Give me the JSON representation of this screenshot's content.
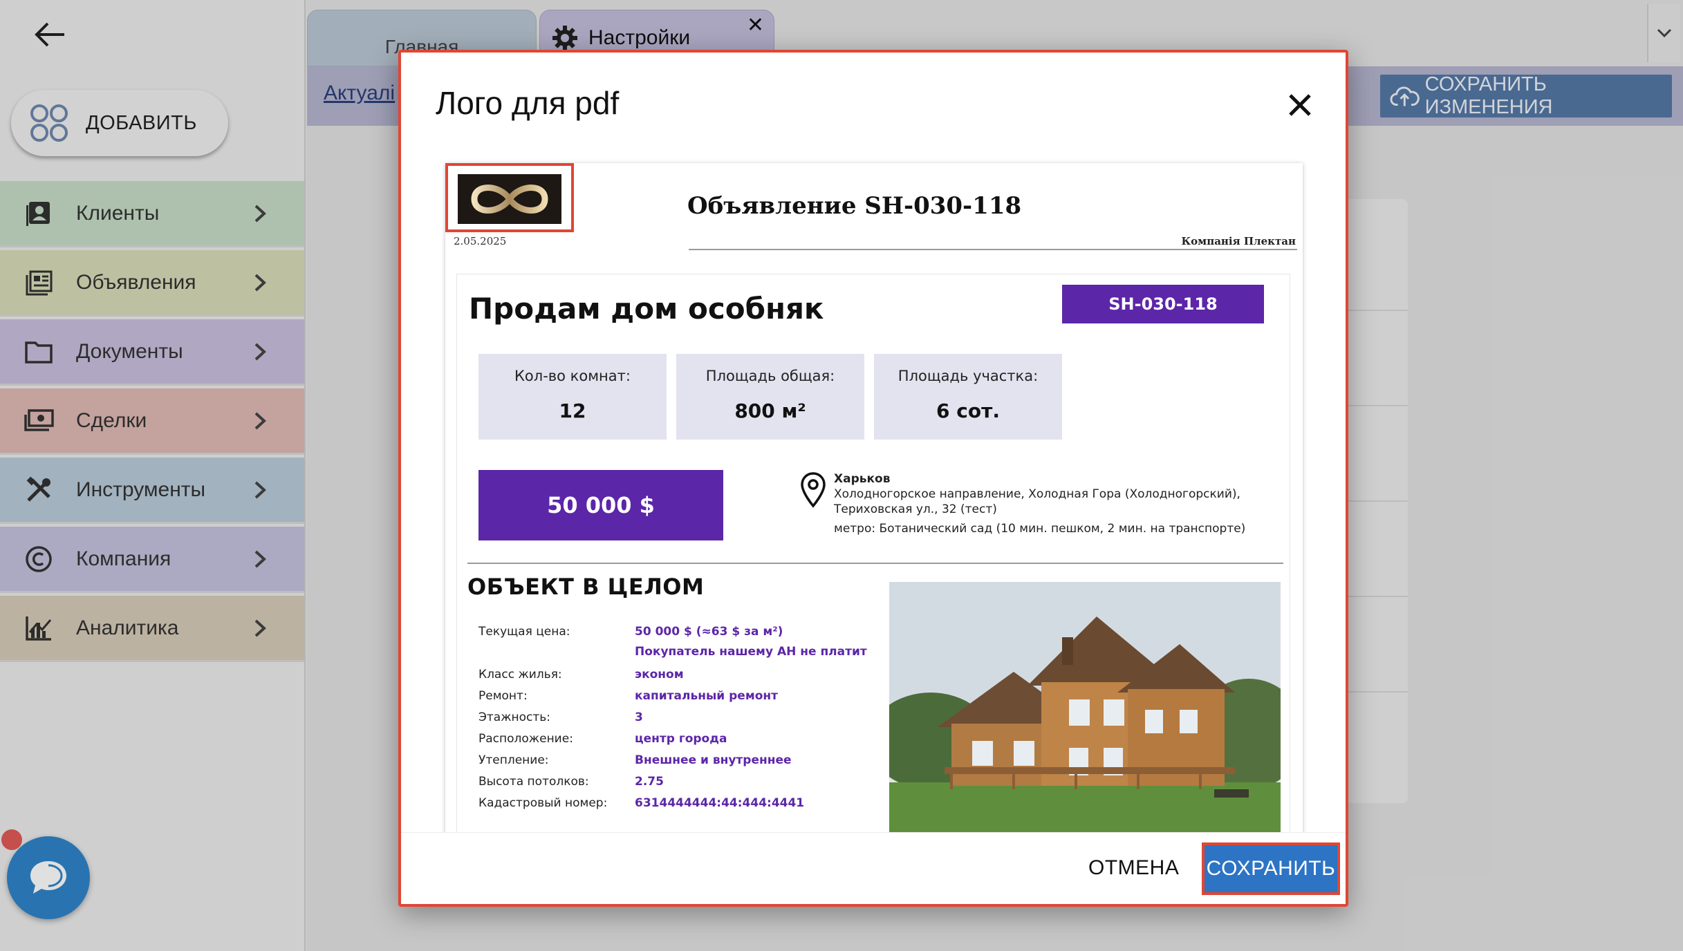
{
  "sidebar": {
    "add_label": "ДОБАВИТЬ",
    "items": [
      {
        "label": "Клиенты",
        "icon": "contacts-icon",
        "color": "#c6dcc7"
      },
      {
        "label": "Объявления",
        "icon": "listings-icon",
        "color": "#d8dcb8"
      },
      {
        "label": "Документы",
        "icon": "folder-icon",
        "color": "#c9c0dd"
      },
      {
        "label": "Сделки",
        "icon": "money-icon",
        "color": "#e0b9b4"
      },
      {
        "label": "Инструменты",
        "icon": "tools-icon",
        "color": "#b9cbda"
      },
      {
        "label": "Компания",
        "icon": "copyright-icon",
        "color": "#c3c2dd"
      },
      {
        "label": "Аналитика",
        "icon": "analytics-icon",
        "color": "#d7cbb8"
      }
    ]
  },
  "tabs": {
    "home": "Главная",
    "settings": "Настройки"
  },
  "toolbar": {
    "link": "Актуалі",
    "save_changes": "СОХРАНИТЬ ИЗМЕНЕНИЯ"
  },
  "dialog": {
    "title": "Лого для pdf",
    "cancel": "ОТМЕНА",
    "save": "СОХРАНИТЬ"
  },
  "pdf": {
    "header_title": "Объявление SH-030-118",
    "date": "2.05.2025",
    "company": "Компанія Плектан",
    "headline": "Продам дом особняк",
    "code": "SH-030-118",
    "stats": [
      {
        "label": "Кол-во комнат:",
        "value": "12"
      },
      {
        "label": "Площадь общая:",
        "value": "800 м²"
      },
      {
        "label": "Площадь участка:",
        "value": "6 сот."
      }
    ],
    "price": "50 000 $",
    "address": {
      "city": "Харьков",
      "line1": "Холодногорское направление, Холодная Гора (Холодногорский),",
      "line2": "Териховская ул., 32 (тест)",
      "metro": "метро: Ботанический сад (10 мин. пешком, 2 мин. на транспорте)"
    },
    "section_title": "ОБЪЕКТ В ЦЕЛОМ",
    "details": [
      {
        "label": "Текущая цена:",
        "value": "50 000 $ (≈63 $ за м²)",
        "value2": "Покупатель нашему АН не платит"
      },
      {
        "label": "Класс жилья:",
        "value": "эконом"
      },
      {
        "label": "Ремонт:",
        "value": "капитальный ремонт"
      },
      {
        "label": "Этажность:",
        "value": "3"
      },
      {
        "label": "Расположение:",
        "value": "центр города"
      },
      {
        "label": "Утепление:",
        "value": "Внешнее и внутреннее"
      },
      {
        "label": "Высота потолков:",
        "value": "2.75"
      },
      {
        "label": "Кадастровый номер:",
        "value": "6314444444:44:444:4441"
      }
    ]
  },
  "colors": {
    "accent_purple": "#5c26a8",
    "save_blue": "#2d74c4",
    "highlight_red": "#e04634"
  }
}
